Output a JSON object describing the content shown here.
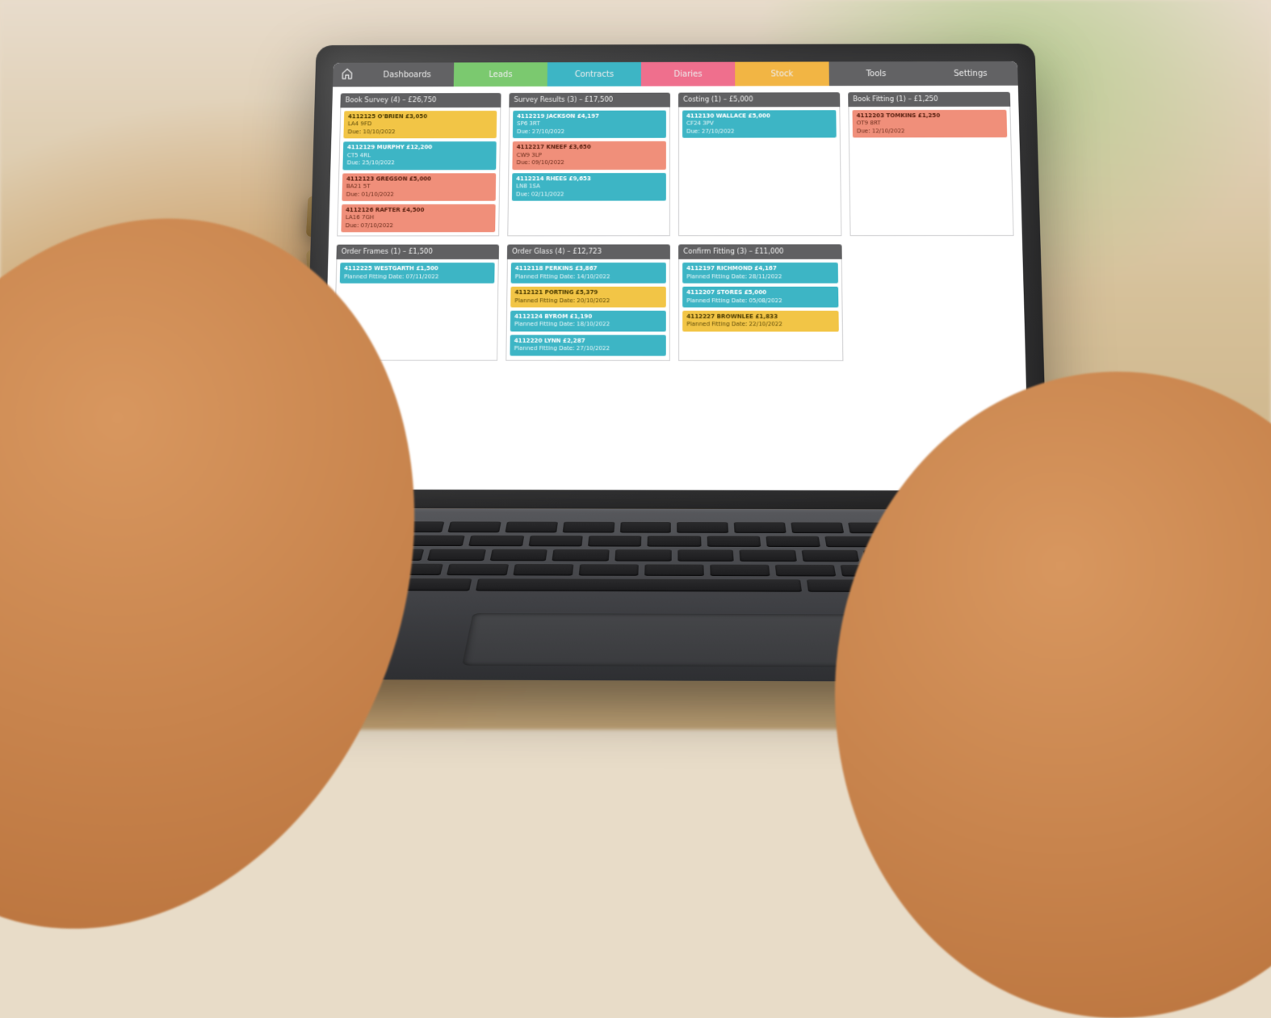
{
  "nav": {
    "dashboards": "Dashboards",
    "leads": "Leads",
    "contracts": "Contracts",
    "diaries": "Diaries",
    "stock": "Stock",
    "tools": "Tools",
    "settings": "Settings"
  },
  "colors": {
    "dashboards": "#626264",
    "leads": "#7bc96f",
    "contracts": "#3db5c5",
    "diaries": "#ef6f8d",
    "stock": "#f2b544",
    "tools": "#626264",
    "settings": "#626264"
  },
  "columns_row1": [
    {
      "title": "Book Survey (4) – £26,750",
      "cards": [
        {
          "color": "c-yellow",
          "line1": "4112125  O'BRIEN  £3,050",
          "line2": "LA4 9FD",
          "line3": "Due: 10/10/2022"
        },
        {
          "color": "c-cyan",
          "line1": "4112129  MURPHY  £12,200",
          "line2": "CT5 4RL",
          "line3": "Due: 25/10/2022"
        },
        {
          "color": "c-salmon",
          "line1": "4112123  GREGSON  £5,000",
          "line2": "BA21 5T",
          "line3": "Due: 01/10/2022"
        },
        {
          "color": "c-salmon",
          "line1": "4112126  RAFTER  £4,500",
          "line2": "LA16 7GH",
          "line3": "Due: 07/10/2022"
        }
      ]
    },
    {
      "title": "Survey Results (3) – £17,500",
      "cards": [
        {
          "color": "c-cyan",
          "line1": "4112219  JACKSON  £4,197",
          "line2": "SP6 3RT",
          "line3": "Due: 27/10/2022"
        },
        {
          "color": "c-salmon",
          "line1": "4112217  KNEEF  £3,650",
          "line2": "CW9 3LP",
          "line3": "Due: 09/10/2022"
        },
        {
          "color": "c-cyan",
          "line1": "4112214  RHEES  £9,653",
          "line2": "LN8 1SA",
          "line3": "Due: 02/11/2022"
        }
      ]
    },
    {
      "title": "Costing (1) – £5,000",
      "cards": [
        {
          "color": "c-cyan",
          "line1": "4112130  WALLACE  £5,000",
          "line2": "CF24 3PV",
          "line3": "Due: 27/10/2022"
        }
      ]
    },
    {
      "title": "Book Fitting (1) – £1,250",
      "cards": [
        {
          "color": "c-salmon",
          "line1": "4112203  TOMKINS  £1,250",
          "line2": "OT9 8RT",
          "line3": "Due: 12/10/2022"
        }
      ]
    }
  ],
  "columns_row2": [
    {
      "title": "Order Frames (1) – £1,500",
      "cards": [
        {
          "color": "c-cyan",
          "line1": "4112225  WESTGARTH  £1,500",
          "line2": "Planned Fitting Date: 07/11/2022",
          "line3": ""
        }
      ]
    },
    {
      "title": "Order Glass (4) – £12,723",
      "cards": [
        {
          "color": "c-cyan",
          "line1": "4112118  PERKINS  £3,867",
          "line2": "Planned Fitting Date: 14/10/2022",
          "line3": ""
        },
        {
          "color": "c-yellow",
          "line1": "4112121  PORTING  £5,379",
          "line2": "Planned Fitting Date: 20/10/2022",
          "line3": ""
        },
        {
          "color": "c-cyan",
          "line1": "4112124  BYROM  £1,190",
          "line2": "Planned Fitting Date: 18/10/2022",
          "line3": ""
        },
        {
          "color": "c-cyan",
          "line1": "4112220  LYNN  £2,287",
          "line2": "Planned Fitting Date: 27/10/2022",
          "line3": ""
        }
      ]
    },
    {
      "title": "Confirm Fitting (3) – £11,000",
      "cards": [
        {
          "color": "c-cyan",
          "line1": "4112197  RICHMOND  £4,167",
          "line2": "Planned Fitting Date: 28/11/2022",
          "line3": ""
        },
        {
          "color": "c-cyan",
          "line1": "4112207  STORES  £5,000",
          "line2": "Planned Fitting Date: 05/08/2022",
          "line3": ""
        },
        {
          "color": "c-yellow",
          "line1": "4112227  BROWNLEE  £1,833",
          "line2": "Planned Fitting Date: 22/10/2022",
          "line3": ""
        }
      ]
    },
    {
      "title": "",
      "cards": []
    }
  ]
}
